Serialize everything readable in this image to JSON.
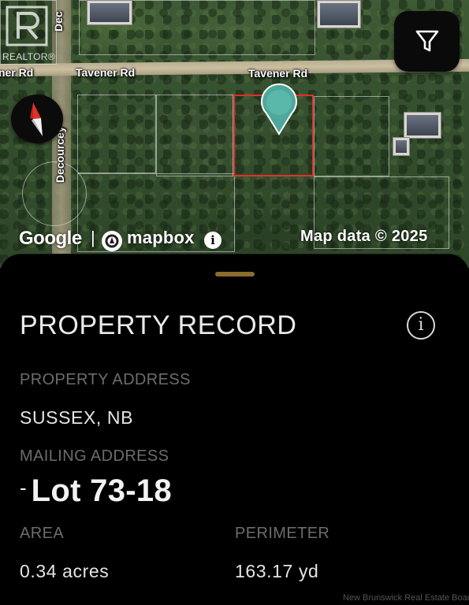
{
  "map": {
    "road_labels": {
      "left_fragment": "ner Rd",
      "tavener_west": "Tavener Rd",
      "tavener_east": "Tavener Rd",
      "decourcey_top": "Dec",
      "decourcey": "Decourcey"
    },
    "realtor_logo_text": "REALTOR®",
    "attribution": {
      "google": "Google",
      "separator": "|",
      "mapbox": "mapbox",
      "info": "i",
      "map_data": "Map data © 2025"
    },
    "icons": {
      "compass": "compass-icon",
      "filter": "filter-icon",
      "pin": "map-pin-icon"
    },
    "colors": {
      "selection": "#e0302b",
      "pin": "#4fa89c"
    }
  },
  "sheet": {
    "title": "PROPERTY RECORD",
    "info_icon": "i",
    "property_address_label": "PROPERTY ADDRESS",
    "property_address": "SUSSEX, NB",
    "mailing_address_label": "MAILING ADDRESS",
    "mailing_dash": "-",
    "mailing_address": "Lot 73-18",
    "area_label": "AREA",
    "area": "0.34 acres",
    "perimeter_label": "PERIMETER",
    "perimeter": "163.17 yd",
    "colors": {
      "grabber": "#8a6d2c"
    }
  },
  "watermark": "New Brunswick Real Estate Board"
}
